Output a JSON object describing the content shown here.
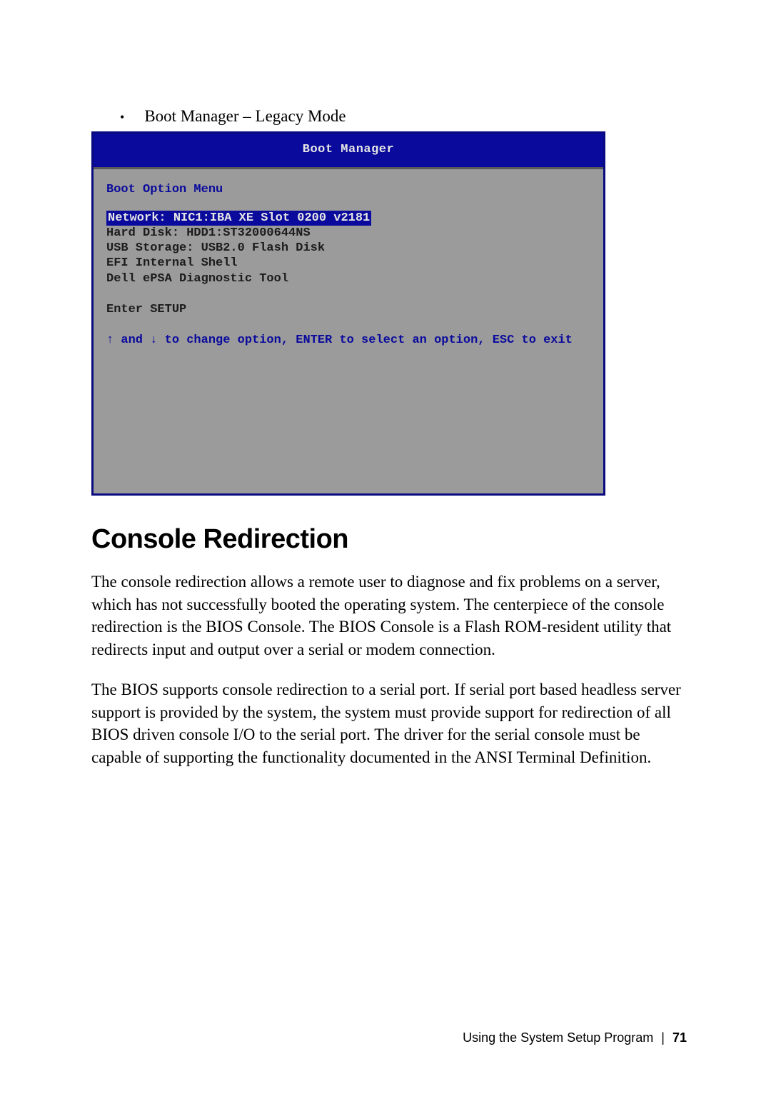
{
  "bullet": {
    "dot": "•",
    "text": "Boot Manager – Legacy Mode"
  },
  "bios": {
    "header_title": "Boot Manager",
    "menu_title": "Boot Option Menu",
    "options": [
      "Network: NIC1:IBA XE Slot 0200 v2181",
      "Hard Disk: HDD1:ST32000644NS",
      "USB Storage: USB2.0  Flash Disk",
      "EFI Internal Shell",
      "Dell ePSA Diagnostic Tool"
    ],
    "setup": "Enter SETUP",
    "help": "↑ and ↓ to change option, ENTER to select an option, ESC to exit"
  },
  "section": {
    "heading": "Console Redirection",
    "para1": "The console redirection allows a remote user to diagnose and fix problems on a server, which has not successfully booted the operating system. The centerpiece of the console redirection is the BIOS Console. The BIOS Console is a Flash ROM-resident utility that redirects input and output over a serial or modem connection.",
    "para2": " The BIOS supports console redirection to a serial port. If serial port based headless server support is provided by the system, the system must provide support for redirection of all BIOS driven console I/O to the serial port. The driver for the serial console must be capable of supporting the functionality documented in the ANSI Terminal Definition."
  },
  "footer": {
    "text": "Using the System Setup Program",
    "divider": "|",
    "page": "71"
  }
}
